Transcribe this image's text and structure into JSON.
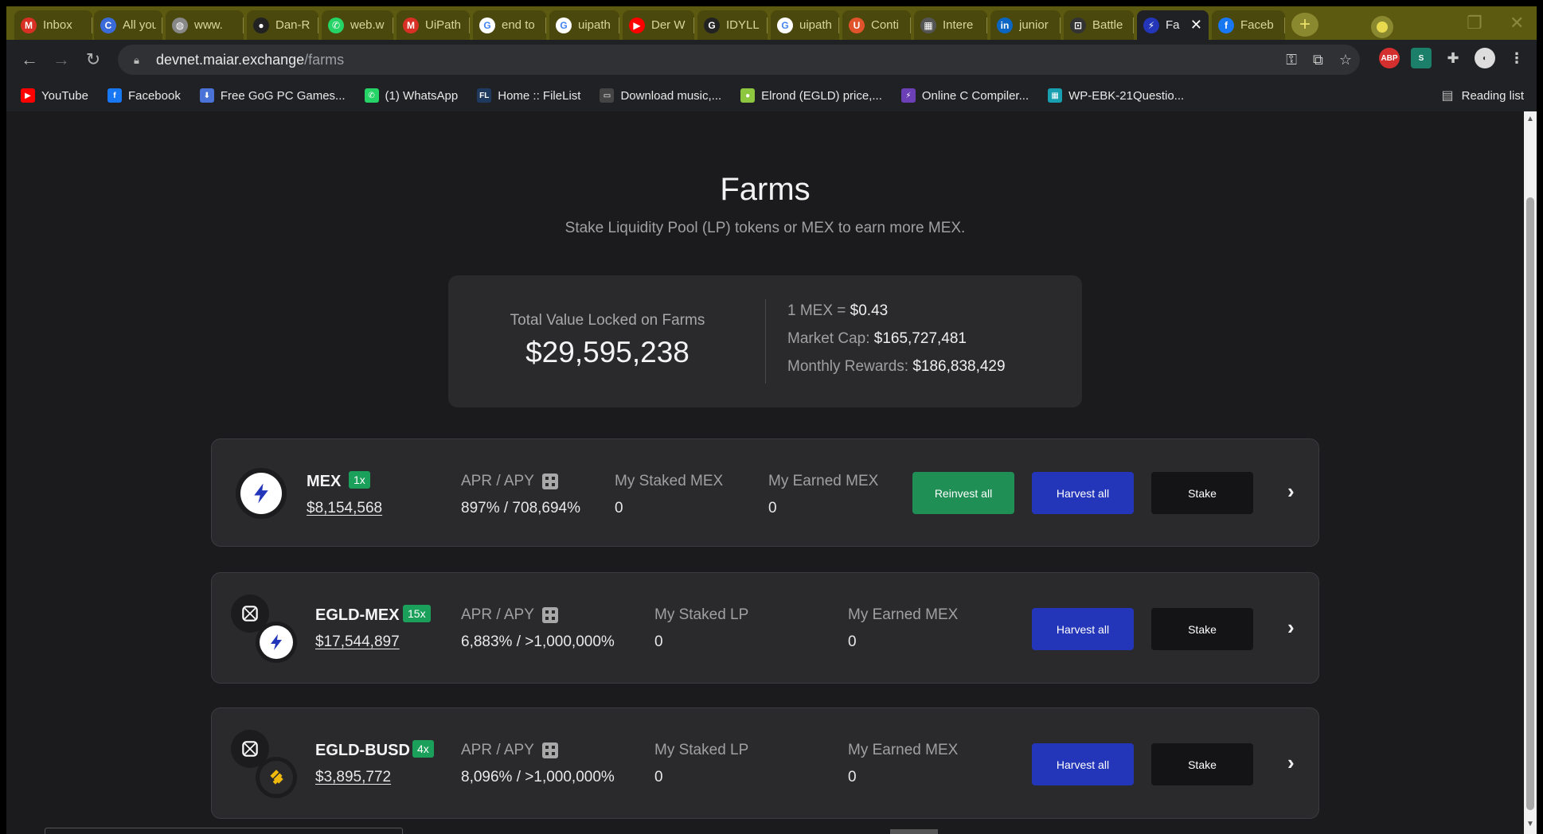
{
  "browser": {
    "tabs": [
      {
        "label": "Inbox",
        "icon": "gmail-icon",
        "color": "#d93025",
        "glyph": "M"
      },
      {
        "label": "All you",
        "icon": "c-logo-icon",
        "color": "#3a6bd8",
        "glyph": "C"
      },
      {
        "label": "www.",
        "icon": "globe-icon",
        "color": "#888888",
        "glyph": "◍"
      },
      {
        "label": "Dan-R",
        "icon": "github-icon",
        "color": "#222222",
        "glyph": "●"
      },
      {
        "label": "web.w",
        "icon": "whatsapp-icon",
        "color": "#25d366",
        "glyph": "✆"
      },
      {
        "label": "UiPath",
        "icon": "gmail-icon",
        "color": "#d93025",
        "glyph": "M"
      },
      {
        "label": "end to",
        "icon": "google-icon",
        "color": "#ffffff",
        "glyph": "G"
      },
      {
        "label": "uipath",
        "icon": "google-icon",
        "color": "#ffffff",
        "glyph": "G"
      },
      {
        "label": "Der W",
        "icon": "youtube-icon",
        "color": "#ff0000",
        "glyph": "▶"
      },
      {
        "label": "IDYLL",
        "icon": "g-logo-icon",
        "color": "#222222",
        "glyph": "G"
      },
      {
        "label": "uipath",
        "icon": "google-icon",
        "color": "#ffffff",
        "glyph": "G"
      },
      {
        "label": "Conti",
        "icon": "udemy-icon",
        "color": "#e0532b",
        "glyph": "U"
      },
      {
        "label": "Intere",
        "icon": "calculator-icon",
        "color": "#555555",
        "glyph": "▦"
      },
      {
        "label": "junior",
        "icon": "linkedin-icon",
        "color": "#0a66c2",
        "glyph": "in"
      },
      {
        "label": "Battle",
        "icon": "app-icon",
        "color": "#333333",
        "glyph": "⊡"
      },
      {
        "label": "Fa",
        "icon": "maiar-bolt-icon",
        "color": "#2335b8",
        "glyph": "⚡",
        "active": true
      },
      {
        "label": "Faceb",
        "icon": "facebook-icon",
        "color": "#1877f2",
        "glyph": "f"
      }
    ],
    "url_host": "devnet.maiar.exchange",
    "url_path": "/farms",
    "bookmarks": [
      {
        "label": "YouTube",
        "icon": "youtube-icon",
        "color": "#ff0000",
        "glyph": "▶"
      },
      {
        "label": "Facebook",
        "icon": "facebook-icon",
        "color": "#1877f2",
        "glyph": "f"
      },
      {
        "label": "Free GoG PC Games...",
        "icon": "download-icon",
        "color": "#4a73d8",
        "glyph": "⬇"
      },
      {
        "label": "(1) WhatsApp",
        "icon": "whatsapp-icon",
        "color": "#25d366",
        "glyph": "✆"
      },
      {
        "label": "Home :: FileList",
        "icon": "filelist-icon",
        "color": "#1e3a5f",
        "glyph": "FL"
      },
      {
        "label": "Download music,...",
        "icon": "music-icon",
        "color": "#444444",
        "glyph": "▭"
      },
      {
        "label": "Elrond (EGLD) price,...",
        "icon": "coingecko-icon",
        "color": "#8dc63f",
        "glyph": "●"
      },
      {
        "label": "Online C Compiler...",
        "icon": "bolt-icon",
        "color": "#6b3fb5",
        "glyph": "⚡"
      },
      {
        "label": "WP-EBK-21Questio...",
        "icon": "grid-icon",
        "color": "#18a0b0",
        "glyph": "▦"
      }
    ],
    "reading_list": "Reading list"
  },
  "page": {
    "title": "Farms",
    "subtitle": "Stake Liquidity Pool (LP) tokens or MEX to earn more MEX.",
    "stats": {
      "tvl_label": "Total Value Locked on Farms",
      "tvl_value": "$29,595,238",
      "mex_price_label": "1 MEX = ",
      "mex_price_value": "$0.43",
      "market_cap_label": "Market Cap: ",
      "market_cap_value": "$165,727,481",
      "monthly_rewards_label": "Monthly Rewards: ",
      "monthly_rewards_value": "$186,838,429"
    },
    "farms": [
      {
        "name": "MEX",
        "multiplier": "1x",
        "value": "$8,154,568",
        "apr_label": "APR / APY",
        "apr_value": "897% / 708,694%",
        "staked_label": "My Staked MEX",
        "staked_value": "0",
        "earned_label": "My Earned MEX",
        "earned_value": "0",
        "reinvest_label": "Reinvest all",
        "harvest_label": "Harvest all",
        "stake_label": "Stake"
      },
      {
        "name": "EGLD-MEX",
        "multiplier": "15x",
        "value": "$17,544,897",
        "apr_label": "APR / APY",
        "apr_value": "6,883% / >1,000,000%",
        "staked_label": "My Staked LP",
        "staked_value": "0",
        "earned_label": "My Earned MEX",
        "earned_value": "0",
        "harvest_label": "Harvest all",
        "stake_label": "Stake"
      },
      {
        "name": "EGLD-BUSD",
        "multiplier": "4x",
        "value": "$3,895,772",
        "apr_label": "APR / APY",
        "apr_value": "8,096% / >1,000,000%",
        "staked_label": "My Staked LP",
        "staked_value": "0",
        "earned_label": "My Earned MEX",
        "earned_value": "0",
        "harvest_label": "Harvest all",
        "stake_label": "Stake"
      }
    ]
  },
  "colors": {
    "tabstrip": "#5c5a10",
    "page_bg": "#1b1b1d",
    "card_bg": "#2a2a2d",
    "reinvest": "#1f8f56",
    "harvest": "#2335b8",
    "stake": "#141416",
    "multiplier": "#1aa05a",
    "busd": "#f0b90b"
  }
}
